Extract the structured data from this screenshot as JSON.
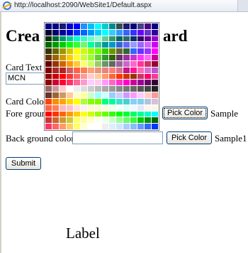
{
  "browser": {
    "url": "http://localhost:2090/WebSite1/Default.aspx"
  },
  "page": {
    "heading_left": "Crea",
    "heading_right": "ard",
    "card_text_label": "Card Text",
    "card_text_value": "MCN",
    "card_color_label": "Card Color",
    "fore_label": "Fore ground",
    "fore_button": "Pick Color",
    "fore_sample": "Sample",
    "back_label": "Back ground color",
    "back_value": "",
    "back_button": "Pick Color",
    "back_sample": "Sample1",
    "submit_button": "Submit",
    "bottom_label": "Label"
  },
  "palette": {
    "rows": [
      [
        "#000080",
        "#00008b",
        "#191970",
        "#0000cd",
        "#0000ff",
        "#1e90ff",
        "#00bfff",
        "#00ffff",
        "#00ced1",
        "#008b8b",
        "#2f4f4f",
        "#191970",
        "#000080",
        "#483d8b",
        "#4b0082",
        "#00008b"
      ],
      [
        "#000033",
        "#000066",
        "#000099",
        "#0000cc",
        "#0033ff",
        "#0066ff",
        "#0099ff",
        "#00ccff",
        "#00ffff",
        "#33ccff",
        "#3399ff",
        "#3366ff",
        "#3333ff",
        "#6600ff",
        "#6633cc",
        "#330099"
      ],
      [
        "#003300",
        "#006633",
        "#009966",
        "#00cc99",
        "#00ffcc",
        "#33ffcc",
        "#66ffcc",
        "#99ffcc",
        "#66cc99",
        "#339966",
        "#006666",
        "#336666",
        "#003366",
        "#330066",
        "#660099",
        "#9900cc"
      ],
      [
        "#006600",
        "#009900",
        "#00cc00",
        "#00ff00",
        "#33ff33",
        "#66ff66",
        "#00ff99",
        "#33cc99",
        "#009999",
        "#0099cc",
        "#3366cc",
        "#6666ff",
        "#9999ff",
        "#9966ff",
        "#cc66ff",
        "#cc00ff"
      ],
      [
        "#333300",
        "#666600",
        "#999900",
        "#cccc00",
        "#ffff00",
        "#ccff00",
        "#99ff00",
        "#66ff00",
        "#33cc00",
        "#669900",
        "#666633",
        "#336633",
        "#3366ff",
        "#6633ff",
        "#9933ff",
        "#ff00ff"
      ],
      [
        "#663300",
        "#996600",
        "#cc9900",
        "#ffcc00",
        "#ffff33",
        "#ccff33",
        "#99ff33",
        "#66cc33",
        "#339933",
        "#336600",
        "#663366",
        "#993399",
        "#cc33cc",
        "#ff33ff",
        "#ff66ff",
        "#cc0099"
      ],
      [
        "#660000",
        "#993300",
        "#cc6600",
        "#ff9900",
        "#ffcc33",
        "#ffff66",
        "#ccff66",
        "#99cc66",
        "#669966",
        "#666666",
        "#996699",
        "#cc66cc",
        "#ff66cc",
        "#ff3399",
        "#cc3366",
        "#990033"
      ],
      [
        "#800000",
        "#a52a2a",
        "#b22222",
        "#cd5c5c",
        "#ff6347",
        "#ff7f50",
        "#ffa07a",
        "#e9967a",
        "#f08080",
        "#fa8072",
        "#db7093",
        "#c71585",
        "#ff1493",
        "#ff69b4",
        "#da70d6",
        "#ba55d3"
      ],
      [
        "#990000",
        "#cc0000",
        "#ff0000",
        "#ff3333",
        "#ff6666",
        "#ff9999",
        "#ffcccc",
        "#ffcc99",
        "#ff9966",
        "#ff6633",
        "#ff3300",
        "#cc3300",
        "#993300",
        "#cc3366",
        "#ff0066",
        "#ff3399"
      ],
      [
        "#8b0000",
        "#cc0033",
        "#ff0033",
        "#ff3366",
        "#ff6699",
        "#ff99cc",
        "#ffccff",
        "#ffccee",
        "#ff99ff",
        "#ff66cc",
        "#ff33cc",
        "#ff00cc",
        "#cc0099",
        "#990099",
        "#660066",
        "#330033"
      ],
      [
        "#996666",
        "#cc9999",
        "#ffcccc",
        "#ffffff",
        "#eeeeee",
        "#dddddd",
        "#cccccc",
        "#bbbbbb",
        "#aaaaaa",
        "#999999",
        "#888888",
        "#777777",
        "#666666",
        "#555555",
        "#444444",
        "#222222"
      ],
      [
        "#663333",
        "#996633",
        "#cc9966",
        "#ffcc99",
        "#ffffcc",
        "#ffff99",
        "#ccffcc",
        "#99ffff",
        "#ccffff",
        "#99ccff",
        "#ccccff",
        "#cc99ff",
        "#ff99ff",
        "#ffccff",
        "#ffcccc",
        "#ff9999"
      ],
      [
        "#ff4500",
        "#ff8c00",
        "#ffa500",
        "#ffd700",
        "#ffff00",
        "#adff2f",
        "#7fff00",
        "#7cfc00",
        "#00ff7f",
        "#00fa9a",
        "#40e0d0",
        "#48d1cc",
        "#87cefa",
        "#87ceeb",
        "#b0c4de",
        "#d8bfd8"
      ],
      [
        "#ff6347",
        "#ff7f50",
        "#ffb6c1",
        "#ffc0cb",
        "#ffe4e1",
        "#fff0f5",
        "#fffacd",
        "#fafad2",
        "#ffffe0",
        "#f0fff0",
        "#f5fffa",
        "#e0ffff",
        "#f0f8ff",
        "#e6e6fa",
        "#fff5ee",
        "#fdf5e6"
      ],
      [
        "#ff0000",
        "#ff3300",
        "#ff6600",
        "#ff9900",
        "#ffcc00",
        "#ffff00",
        "#ccff00",
        "#99ff00",
        "#66ff00",
        "#33ff00",
        "#00ff00",
        "#00ff33",
        "#00ff66",
        "#00ff99",
        "#00ffcc",
        "#00ffff"
      ],
      [
        "#cc3333",
        "#cc6633",
        "#cc9933",
        "#cccc33",
        "#ffff66",
        "#ffff99",
        "#ffffcc",
        "#ffffee",
        "#eeffee",
        "#ccffcc",
        "#99ff99",
        "#66ff66",
        "#33ff33",
        "#00cc00",
        "#009900",
        "#006600"
      ],
      [
        "#ff3366",
        "#ff6666",
        "#ff9966",
        "#ffcc66",
        "#ffff66",
        "#ffffcc",
        "#ffffff",
        "#ffffff",
        "#eeeeee",
        "#ddeeff",
        "#cce6ff",
        "#aaccff",
        "#88bbff",
        "#6699ff",
        "#3366ff",
        "#0033ff"
      ]
    ]
  }
}
